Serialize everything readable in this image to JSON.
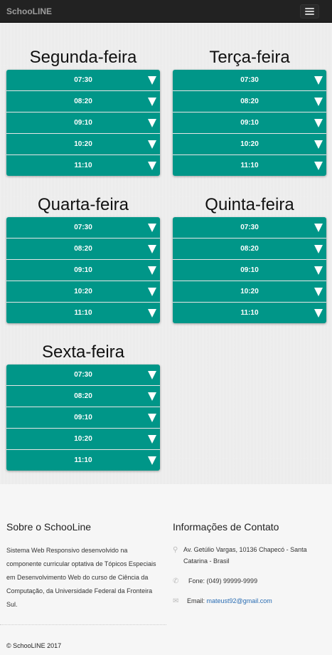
{
  "navbar": {
    "brand": "SchooLINE",
    "menu_icon": "hamburger-icon"
  },
  "schedule": {
    "monday": {
      "title": "Segunda-feira",
      "times": [
        "07:30",
        "08:20",
        "09:10",
        "10:20",
        "11:10"
      ]
    },
    "tuesday": {
      "title": "Terça-feira",
      "times": [
        "07:30",
        "08:20",
        "09:10",
        "10:20",
        "11:10"
      ]
    },
    "wednesday": {
      "title": "Quarta-feira",
      "times": [
        "07:30",
        "08:20",
        "09:10",
        "10:20",
        "11:10"
      ]
    },
    "thursday": {
      "title": "Quinta-feira",
      "times": [
        "07:30",
        "08:20",
        "09:10",
        "10:20",
        "11:10"
      ]
    },
    "friday": {
      "title": "Sexta-feira",
      "times": [
        "07:30",
        "08:20",
        "09:10",
        "10:20",
        "11:10"
      ]
    }
  },
  "footer": {
    "about_title": "Sobre o SchooLine",
    "about_text": "Sistema Web Responsivo desenvolvido na componente curricular optativa de Tópicos Especiais em Desenvolvimento Web do curso de Ciência da Computação, da Universidade Federal da Fronteira Sul.",
    "contact_title": "Informações de Contato",
    "address": "Av. Getúlio Vargas, 10136 Chapecó - Santa Catarina - Brasil",
    "phone": "Fone: (049) 99999-9999",
    "email_label": "Email:",
    "email": "mateust92@gmail.com",
    "copyright": "© SchooLINE 2017"
  },
  "colors": {
    "slot": "#009688",
    "navbar": "#222222",
    "link": "#2a6db3"
  }
}
